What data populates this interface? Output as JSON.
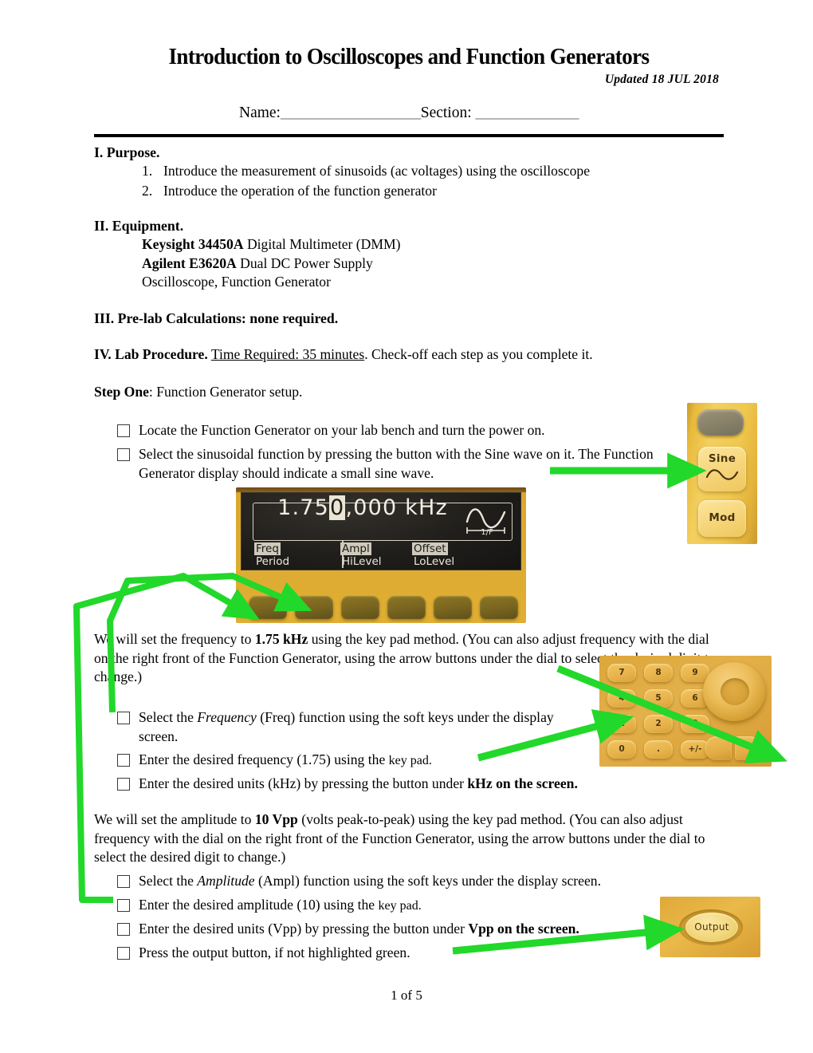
{
  "document": {
    "title": "Introduction to Oscilloscopes and Function Generators",
    "updated": "Updated 18 JUL 2018",
    "name_label": "Name:",
    "name_blank": "___________________",
    "section_label": "Section:",
    "section_blank": "______________",
    "footer": "1 of 5"
  },
  "sections": {
    "purpose": {
      "heading": "I.  Purpose.",
      "items": [
        {
          "num": "1.",
          "text": "Introduce the measurement of sinusoids (ac voltages) using the oscilloscope"
        },
        {
          "num": "2.",
          "text": "Introduce the operation of the function generator"
        }
      ]
    },
    "equipment": {
      "heading": "II.  Equipment.",
      "lines": [
        {
          "bold": "Keysight 34450A",
          "rest": " Digital Multimeter (DMM)"
        },
        {
          "bold": "Agilent E3620A",
          "rest": " Dual DC Power Supply"
        },
        {
          "bold": "",
          "rest": "Oscilloscope,   Function Generator"
        }
      ]
    },
    "prelab": {
      "heading": "III. Pre-lab Calculations: none required."
    },
    "procedure": {
      "heading": "IV.  Lab Procedure.",
      "time_required": "Time Required: 35 minutes",
      "tail": ". Check-off each step as you complete it."
    },
    "step_one": {
      "label": "Step One",
      "text": ":  Function Generator setup."
    }
  },
  "checklist_one": [
    {
      "text": "Locate the Function Generator on your lab bench and turn the power on."
    },
    {
      "text": "Select the sinusoidal function by pressing the button with the Sine wave on it.  The Function Generator display should indicate a small sine wave."
    }
  ],
  "paragraph_frequency": {
    "part1": "We will set the frequency to ",
    "bold": "1.75 kHz",
    "part2": " using the key pad method. (You can also adjust frequency with the dial on the right front of the Function Generator, using the arrow buttons under the dial to select the desired digit to change.)"
  },
  "checklist_frequency": [
    {
      "pre": "Select the ",
      "ital": "Frequency",
      "post": " (Freq) function using the soft keys under the display screen."
    },
    {
      "pre": "Enter the desired frequency (1.75) using the ",
      "ital": "",
      "post": "key pad."
    },
    {
      "pre": "Enter the desired units (kHz) by pressing the button under ",
      "ital": "",
      "post": "kHz on the screen."
    }
  ],
  "paragraph_amplitude": {
    "part1": "We will set the amplitude to ",
    "bold": "10 Vpp",
    "part2": " (volts peak-to-peak) using the key pad method. (You can also adjust frequency with the dial on the right front of the Function Generator, using the arrow buttons under the dial to select the desired digit to change.)"
  },
  "checklist_amplitude": [
    {
      "pre": "Select the ",
      "ital": "Amplitude",
      "post": " (Ampl) function using the soft keys under the display screen."
    },
    {
      "pre": "Enter the desired amplitude (10) using the ",
      "ital": "",
      "post": "key pad."
    },
    {
      "pre": " Enter the desired units (Vpp) by pressing the button under ",
      "ital": "",
      "post": "Vpp on the screen."
    },
    {
      "pre": "Press the output button, if not highlighted green.",
      "ital": "",
      "post": ""
    }
  ],
  "photos": {
    "sine_panel": {
      "sine_label": "Sine",
      "mod_label": "Mod"
    },
    "fg_display": {
      "value_pre": "1.75",
      "value_cursor": "0",
      "value_post": ",000",
      "units": "kHz",
      "wave_marker": "1/F",
      "softkeys": [
        {
          "top": "Freq",
          "bottom": "Period"
        },
        {
          "top": "Ampl",
          "bottom": "HiLevel"
        },
        {
          "top": "Offset",
          "bottom": "LoLevel"
        }
      ]
    },
    "keypad": {
      "keys": [
        "7",
        "8",
        "9",
        "4",
        "5",
        "6",
        "1",
        "2",
        "3",
        "0",
        ".",
        "+/-"
      ]
    },
    "output_panel": {
      "label": "Output"
    }
  },
  "colors": {
    "arrow_green": "#22d82a",
    "panel_yellow": "#e8b93c",
    "rule_black": "#000000"
  }
}
